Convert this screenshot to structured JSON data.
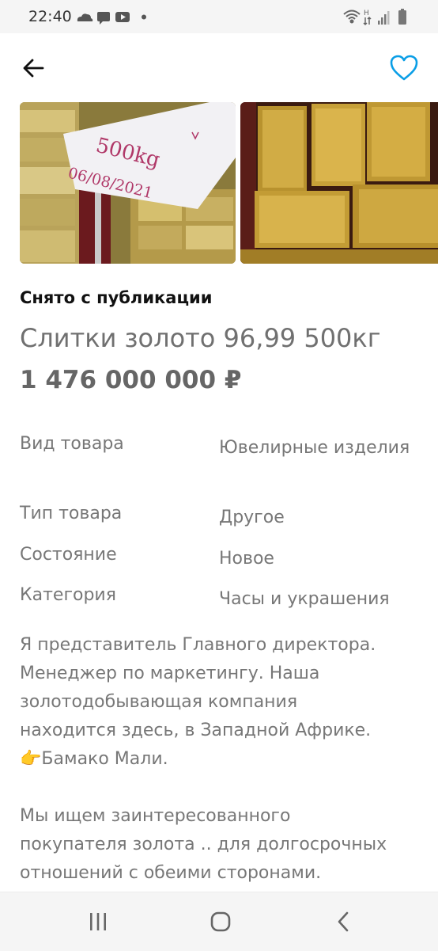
{
  "status_bar": {
    "time": "22:40",
    "left_icons": [
      "cloud-icon",
      "message-icon",
      "youtube-icon",
      "dot-icon"
    ],
    "right_icons": [
      "wifi-icon",
      "data-arrows-icon",
      "signal-icon",
      "battery-icon"
    ],
    "network_badge": "H"
  },
  "app_bar": {
    "back_icon": "arrow-left-icon",
    "favorite_icon": "heart-outline-icon",
    "accent_color": "#0a9ee6"
  },
  "gallery": {
    "photos": [
      {
        "name": "gold-bars-photo-with-note",
        "note_line1": "500kg",
        "note_line2": "06/08/2021"
      },
      {
        "name": "gold-bars-photo"
      }
    ]
  },
  "listing": {
    "status": "Снято с публикации",
    "title": "Слитки золото 96,99 500кг",
    "price": "1 476 000 000 ₽"
  },
  "params": [
    {
      "label": "Вид товара",
      "value": "Ювелирные изделия"
    },
    {
      "label": "Тип товара",
      "value": "Другое"
    },
    {
      "label": "Состояние",
      "value": "Новое"
    },
    {
      "label": "Категория",
      "value": "Часы и украшения"
    }
  ],
  "description": {
    "paragraph1": "Я представитель Главного директора.\nМенеджер по маркетингу. Наша\nзолотодобывающая компания\nнаходится здесь, в Западной Африке.",
    "emoji": "👉",
    "paragraph1_tail": "Бамако Мали.",
    "paragraph2": "Мы ищем заинтересованного\nпокупателя золота .. для долгосрочных\nотношений с обеими сторонами."
  },
  "nav_bar": {
    "buttons": [
      "recent-apps-icon",
      "home-icon",
      "back-icon"
    ]
  }
}
